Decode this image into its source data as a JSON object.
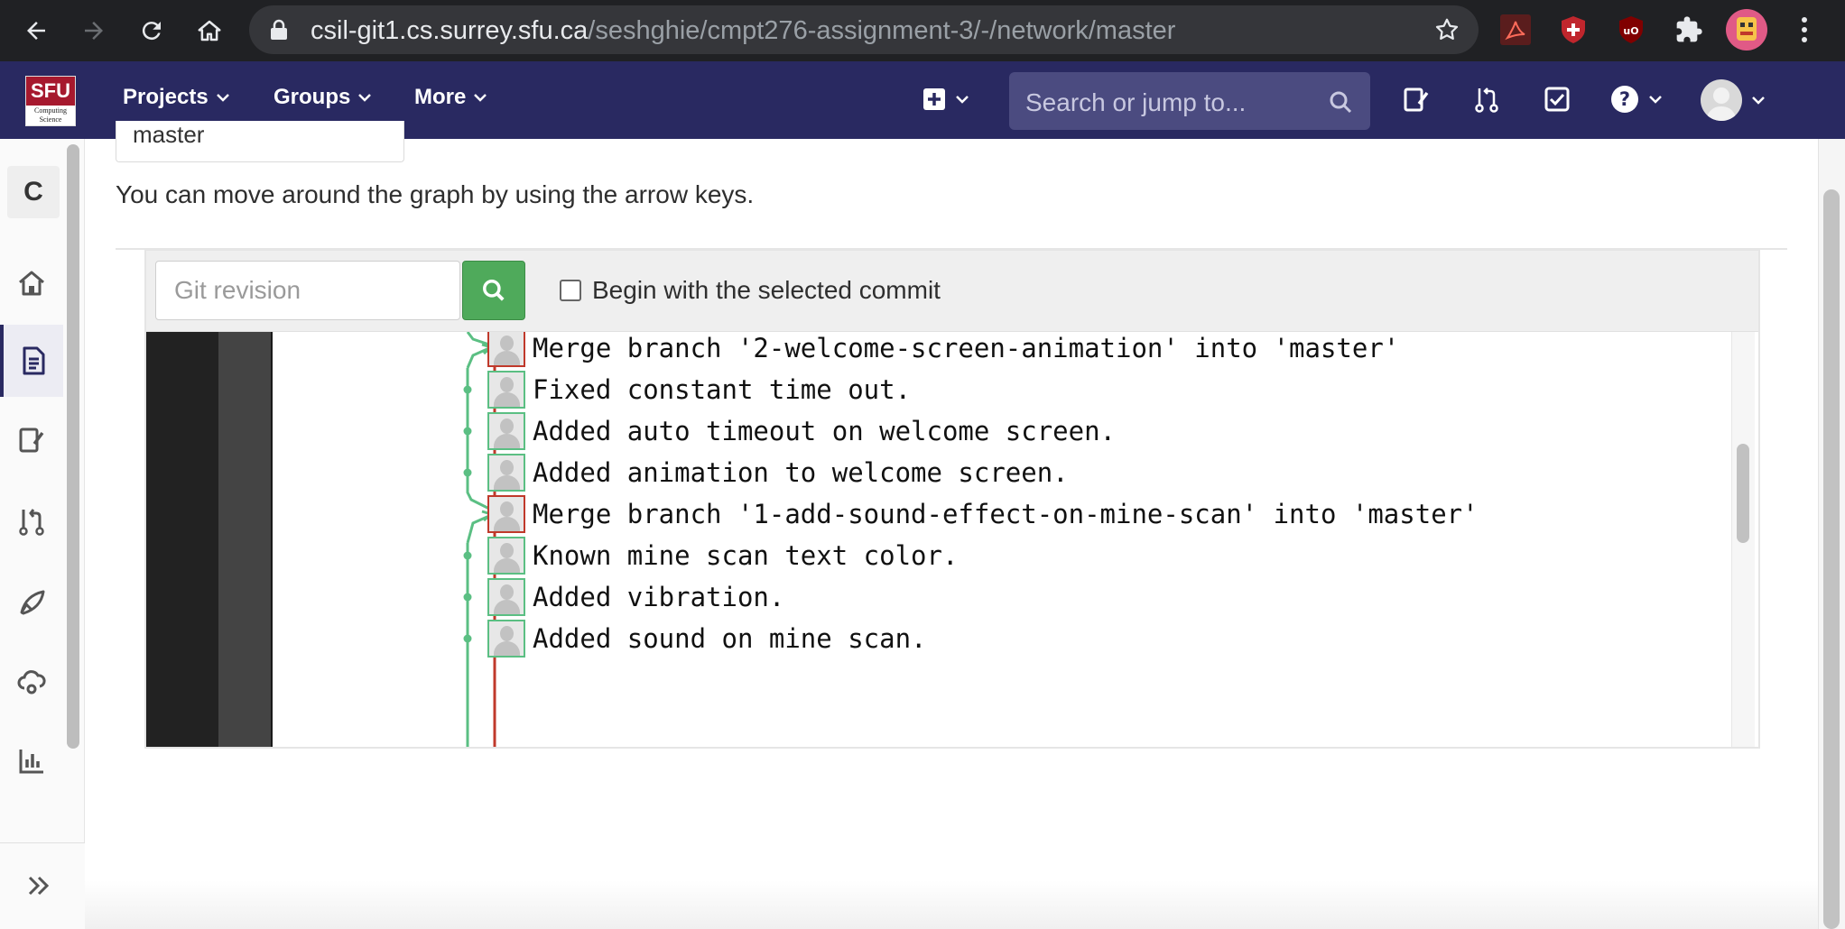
{
  "browser": {
    "url_host": "csil-git1.cs.surrey.sfu.ca",
    "url_path": "/seshghie/cmpt276-assignment-3/-/network/master"
  },
  "header": {
    "logo_text": "SFU",
    "logo_subtext": "Computing Science",
    "menu": [
      {
        "label": "Projects"
      },
      {
        "label": "Groups"
      },
      {
        "label": "More"
      }
    ],
    "search_placeholder": "Search or jump to..."
  },
  "sidebar": {
    "project_initial": "C",
    "items": [
      {
        "name": "project-overview",
        "icon": "home-icon"
      },
      {
        "name": "repository",
        "icon": "file-icon",
        "active": true
      },
      {
        "name": "issues",
        "icon": "issues-icon"
      },
      {
        "name": "merge-requests",
        "icon": "merge-request-icon"
      },
      {
        "name": "ci-cd",
        "icon": "rocket-icon"
      },
      {
        "name": "operations",
        "icon": "cloud-gear-icon"
      },
      {
        "name": "analytics",
        "icon": "chart-icon"
      }
    ]
  },
  "main": {
    "branch_value": "master",
    "hint": "You can move around the graph by using the arrow keys.",
    "revision_placeholder": "Git revision",
    "begin_with_selected_label": "Begin with the selected commit",
    "commits": [
      {
        "message": "Merge branch '2-welcome-screen-animation' into 'master'",
        "merge": true
      },
      {
        "message": "Fixed constant time out.",
        "merge": false
      },
      {
        "message": "Added auto timeout on welcome screen.",
        "merge": false
      },
      {
        "message": "Added animation to welcome screen.",
        "merge": false
      },
      {
        "message": "Merge branch '1-add-sound-effect-on-mine-scan' into 'master'",
        "merge": true
      },
      {
        "message": "Known mine scan text color.",
        "merge": false
      },
      {
        "message": "Added vibration.",
        "merge": false
      },
      {
        "message": "Added sound on mine scan.",
        "merge": false
      }
    ]
  },
  "colors": {
    "header_bg": "#292961",
    "master_line": "#c0392b",
    "branch_line": "#5bbf83",
    "search_button": "#4faa5b"
  }
}
